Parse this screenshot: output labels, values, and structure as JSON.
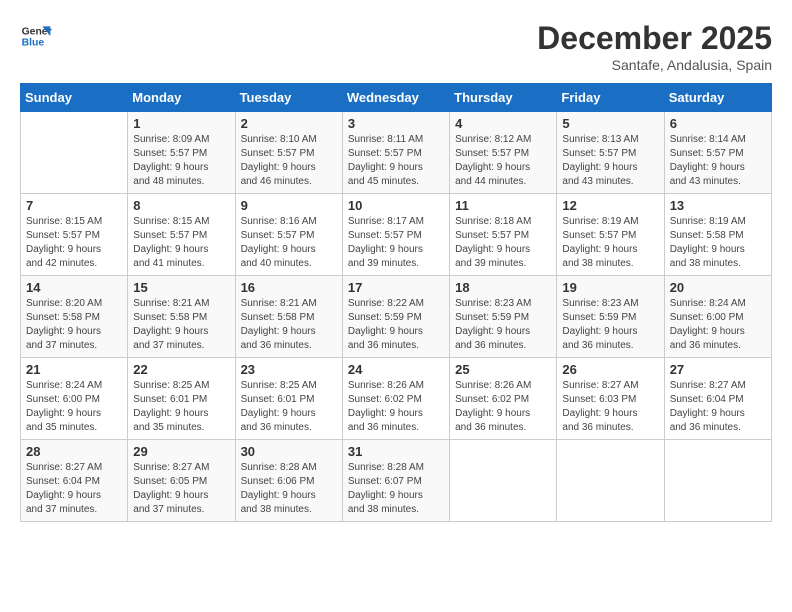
{
  "logo": {
    "line1": "General",
    "line2": "Blue"
  },
  "title": "December 2025",
  "subtitle": "Santafe, Andalusia, Spain",
  "weekdays": [
    "Sunday",
    "Monday",
    "Tuesday",
    "Wednesday",
    "Thursday",
    "Friday",
    "Saturday"
  ],
  "weeks": [
    [
      {
        "day": "",
        "info": ""
      },
      {
        "day": "1",
        "info": "Sunrise: 8:09 AM\nSunset: 5:57 PM\nDaylight: 9 hours\nand 48 minutes."
      },
      {
        "day": "2",
        "info": "Sunrise: 8:10 AM\nSunset: 5:57 PM\nDaylight: 9 hours\nand 46 minutes."
      },
      {
        "day": "3",
        "info": "Sunrise: 8:11 AM\nSunset: 5:57 PM\nDaylight: 9 hours\nand 45 minutes."
      },
      {
        "day": "4",
        "info": "Sunrise: 8:12 AM\nSunset: 5:57 PM\nDaylight: 9 hours\nand 44 minutes."
      },
      {
        "day": "5",
        "info": "Sunrise: 8:13 AM\nSunset: 5:57 PM\nDaylight: 9 hours\nand 43 minutes."
      },
      {
        "day": "6",
        "info": "Sunrise: 8:14 AM\nSunset: 5:57 PM\nDaylight: 9 hours\nand 43 minutes."
      }
    ],
    [
      {
        "day": "7",
        "info": "Sunrise: 8:15 AM\nSunset: 5:57 PM\nDaylight: 9 hours\nand 42 minutes."
      },
      {
        "day": "8",
        "info": "Sunrise: 8:15 AM\nSunset: 5:57 PM\nDaylight: 9 hours\nand 41 minutes."
      },
      {
        "day": "9",
        "info": "Sunrise: 8:16 AM\nSunset: 5:57 PM\nDaylight: 9 hours\nand 40 minutes."
      },
      {
        "day": "10",
        "info": "Sunrise: 8:17 AM\nSunset: 5:57 PM\nDaylight: 9 hours\nand 39 minutes."
      },
      {
        "day": "11",
        "info": "Sunrise: 8:18 AM\nSunset: 5:57 PM\nDaylight: 9 hours\nand 39 minutes."
      },
      {
        "day": "12",
        "info": "Sunrise: 8:19 AM\nSunset: 5:57 PM\nDaylight: 9 hours\nand 38 minutes."
      },
      {
        "day": "13",
        "info": "Sunrise: 8:19 AM\nSunset: 5:58 PM\nDaylight: 9 hours\nand 38 minutes."
      }
    ],
    [
      {
        "day": "14",
        "info": "Sunrise: 8:20 AM\nSunset: 5:58 PM\nDaylight: 9 hours\nand 37 minutes."
      },
      {
        "day": "15",
        "info": "Sunrise: 8:21 AM\nSunset: 5:58 PM\nDaylight: 9 hours\nand 37 minutes."
      },
      {
        "day": "16",
        "info": "Sunrise: 8:21 AM\nSunset: 5:58 PM\nDaylight: 9 hours\nand 36 minutes."
      },
      {
        "day": "17",
        "info": "Sunrise: 8:22 AM\nSunset: 5:59 PM\nDaylight: 9 hours\nand 36 minutes."
      },
      {
        "day": "18",
        "info": "Sunrise: 8:23 AM\nSunset: 5:59 PM\nDaylight: 9 hours\nand 36 minutes."
      },
      {
        "day": "19",
        "info": "Sunrise: 8:23 AM\nSunset: 5:59 PM\nDaylight: 9 hours\nand 36 minutes."
      },
      {
        "day": "20",
        "info": "Sunrise: 8:24 AM\nSunset: 6:00 PM\nDaylight: 9 hours\nand 36 minutes."
      }
    ],
    [
      {
        "day": "21",
        "info": "Sunrise: 8:24 AM\nSunset: 6:00 PM\nDaylight: 9 hours\nand 35 minutes."
      },
      {
        "day": "22",
        "info": "Sunrise: 8:25 AM\nSunset: 6:01 PM\nDaylight: 9 hours\nand 35 minutes."
      },
      {
        "day": "23",
        "info": "Sunrise: 8:25 AM\nSunset: 6:01 PM\nDaylight: 9 hours\nand 36 minutes."
      },
      {
        "day": "24",
        "info": "Sunrise: 8:26 AM\nSunset: 6:02 PM\nDaylight: 9 hours\nand 36 minutes."
      },
      {
        "day": "25",
        "info": "Sunrise: 8:26 AM\nSunset: 6:02 PM\nDaylight: 9 hours\nand 36 minutes."
      },
      {
        "day": "26",
        "info": "Sunrise: 8:27 AM\nSunset: 6:03 PM\nDaylight: 9 hours\nand 36 minutes."
      },
      {
        "day": "27",
        "info": "Sunrise: 8:27 AM\nSunset: 6:04 PM\nDaylight: 9 hours\nand 36 minutes."
      }
    ],
    [
      {
        "day": "28",
        "info": "Sunrise: 8:27 AM\nSunset: 6:04 PM\nDaylight: 9 hours\nand 37 minutes."
      },
      {
        "day": "29",
        "info": "Sunrise: 8:27 AM\nSunset: 6:05 PM\nDaylight: 9 hours\nand 37 minutes."
      },
      {
        "day": "30",
        "info": "Sunrise: 8:28 AM\nSunset: 6:06 PM\nDaylight: 9 hours\nand 38 minutes."
      },
      {
        "day": "31",
        "info": "Sunrise: 8:28 AM\nSunset: 6:07 PM\nDaylight: 9 hours\nand 38 minutes."
      },
      {
        "day": "",
        "info": ""
      },
      {
        "day": "",
        "info": ""
      },
      {
        "day": "",
        "info": ""
      }
    ]
  ]
}
